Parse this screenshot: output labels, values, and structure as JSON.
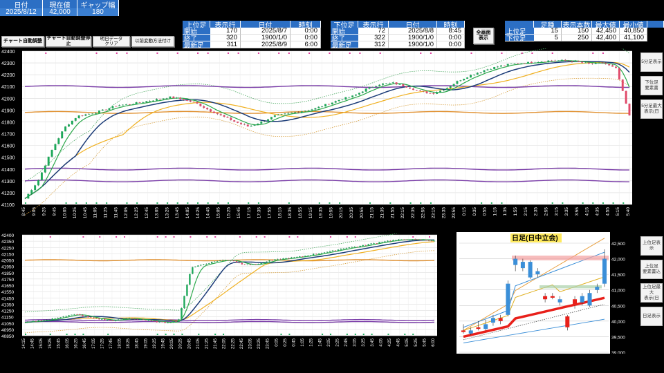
{
  "quote_table": {
    "headers": [
      "日付",
      "現在値",
      "ギャップ幅"
    ],
    "values": [
      "2025/8/12",
      "42,000",
      "180"
    ]
  },
  "buttons": {
    "chart_auto": "チャート自動調整",
    "chart_auto_stop": "チャート自動調整停止",
    "tomorrow_clear": "明日データ\nクリア",
    "before_disp": "以前変動方法付け",
    "full_screen": "全画面\n表示"
  },
  "upper_table": {
    "headers": [
      "上位足",
      "表示行",
      "日付",
      "時刻"
    ],
    "rows": [
      {
        "label": "開始",
        "row": "170",
        "date": "2025/8/7",
        "time": "0:00"
      },
      {
        "label": "終了",
        "row": "320",
        "date": "1900/1/0",
        "time": "0:00"
      },
      {
        "label": "最新足",
        "row": "311",
        "date": "2025/8/9",
        "time": "6:00"
      }
    ]
  },
  "lower_table": {
    "headers": [
      "下位足",
      "表示行",
      "日付",
      "時刻"
    ],
    "rows": [
      {
        "label": "開始",
        "row": "72",
        "date": "2025/8/8",
        "time": "8:45"
      },
      {
        "label": "終了",
        "row": "322",
        "date": "1900/1/0",
        "time": "0:00"
      },
      {
        "label": "最新足",
        "row": "312",
        "date": "1900/1/0",
        "time": "0:00"
      }
    ]
  },
  "ashi_table": {
    "headers": [
      "",
      "足種",
      "表示本数",
      "最大値",
      "最小値"
    ],
    "rows": [
      {
        "label": "上位足",
        "kind": "15",
        "count": "150",
        "max": "42,450",
        "min": "40,850"
      },
      {
        "label": "下位足",
        "kind": "5",
        "count": "250",
        "max": "42,400",
        "min": "41,100"
      }
    ]
  },
  "side_buttons": {
    "upper": [
      "5分足表示",
      "下位足\n要素書",
      "5分足最大\n表示(日"
    ],
    "lower": [
      "上位足表示",
      "上位足\n要素書込",
      "上位足最大\n表示(日",
      "日足表示"
    ]
  },
  "colors": {
    "header_blue": "#2c6fc4",
    "bull": "#1ea85a",
    "bear": "#e04a6a",
    "ma_fast": "#2aa84a",
    "ma_mid": "#1c3c78",
    "ma_slow": "#f0b020",
    "band": "#7a3da8",
    "day_up": "#3b8fd8",
    "day_down": "#e8201a"
  },
  "chart_data": [
    {
      "type": "candlestick",
      "title": "",
      "ylim": [
        41100,
        42400
      ],
      "y_ticks": [
        "42400",
        "42300",
        "42200",
        "42100",
        "42000",
        "41900",
        "41800",
        "41700",
        "41600",
        "41500",
        "41400",
        "41300",
        "41200",
        "41100"
      ],
      "x_ticks": [
        "8:45",
        "9:05",
        "9:25",
        "9:45",
        "10:05",
        "10:25",
        "10:45",
        "11:05",
        "11:25",
        "11:45",
        "12:05",
        "12:25",
        "12:45",
        "13:05",
        "13:25",
        "13:45",
        "14:05",
        "14:25",
        "14:45",
        "15:05",
        "15:25",
        "15:45",
        "17:15",
        "17:35",
        "17:55",
        "18:15",
        "18:35",
        "18:55",
        "19:15",
        "19:35",
        "19:55",
        "20:15",
        "20:35",
        "20:55",
        "21:15",
        "21:35",
        "21:55",
        "22:15",
        "22:35",
        "22:55",
        "23:15",
        "23:35",
        "23:55",
        "0:15",
        "0:35",
        "0:55",
        "1:15",
        "1:35",
        "1:55",
        "2:15",
        "2:35",
        "2:55",
        "3:15",
        "3:35",
        "3:55",
        "4:15",
        "4:35",
        "4:55",
        "5:15",
        "5:40"
      ],
      "close_path": [
        41150,
        41300,
        41550,
        41750,
        41850,
        41870,
        41900,
        41940,
        41950,
        41970,
        41990,
        42010,
        41990,
        41960,
        41900,
        41850,
        41800,
        41760,
        41800,
        41850,
        41870,
        41890,
        41910,
        41950,
        41990,
        42020,
        42080,
        42120,
        42130,
        42100,
        42060,
        42040,
        42080,
        42150,
        42200,
        42240,
        42270,
        42290,
        42300,
        42310,
        42320,
        42320,
        42310,
        42290,
        42300,
        42250,
        41850
      ],
      "bands": [
        41200,
        41900,
        42100,
        41300
      ]
    },
    {
      "type": "candlestick",
      "title": "",
      "ylim": [
        40850,
        42400
      ],
      "y_ticks": [
        "42400",
        "42350",
        "42250",
        "42150",
        "42050",
        "41950",
        "41850",
        "41750",
        "41650",
        "41550",
        "41450",
        "41350",
        "41250",
        "41150",
        "41050",
        "40950",
        "40850"
      ],
      "x_ticks": [
        "14:15",
        "14:45",
        "15:05",
        "15:25",
        "15:45",
        "16:05",
        "16:25",
        "16:45",
        "17:05",
        "17:25",
        "17:45",
        "18:05",
        "18:25",
        "18:45",
        "19:05",
        "19:25",
        "19:45",
        "20:05",
        "20:25",
        "20:45",
        "21:05",
        "21:25",
        "21:45",
        "22:05",
        "22:25",
        "22:45",
        "23:05",
        "23:25",
        "23:45",
        "0:05",
        "0:25",
        "0:45",
        "1:05",
        "1:25",
        "1:45",
        "2:05",
        "2:25",
        "2:45",
        "3:05",
        "3:25",
        "3:45",
        "4:05",
        "4:25",
        "4:45",
        "5:05",
        "5:25",
        "5:45",
        "6:00"
      ],
      "close_path": [
        41050,
        41080,
        41100,
        41150,
        41180,
        41130,
        41100,
        41080,
        41120,
        41100,
        41070,
        41050,
        41080,
        41900,
        41950,
        42000,
        42020,
        41950,
        41940,
        42000,
        42030,
        42050,
        42080,
        42120,
        42150,
        42200,
        42220,
        42260,
        42300,
        42320,
        42330,
        42320,
        42310
      ]
    },
    {
      "type": "candlestick",
      "title": "日足(日中立会)",
      "ylim": [
        39000,
        42500
      ],
      "y_ticks": [
        "42,500",
        "42,000",
        "41,500",
        "41,000",
        "40,500",
        "40,000",
        "39,500",
        "39,000"
      ],
      "candles": [
        {
          "o": 39700,
          "c": 39650,
          "h": 39900,
          "l": 39600
        },
        {
          "o": 39600,
          "c": 39700,
          "h": 39800,
          "l": 39550
        },
        {
          "o": 39800,
          "c": 39750,
          "h": 40000,
          "l": 39700
        },
        {
          "o": 39750,
          "c": 39900,
          "h": 40050,
          "l": 39700
        },
        {
          "o": 39950,
          "c": 40100,
          "h": 40200,
          "l": 39850
        },
        {
          "o": 40100,
          "c": 40000,
          "h": 40200,
          "l": 39900
        },
        {
          "o": 40200,
          "c": 41200,
          "h": 41300,
          "l": 40150
        },
        {
          "o": 41800,
          "c": 42000,
          "h": 42100,
          "l": 41600
        },
        {
          "o": 41700,
          "c": 41900,
          "h": 42000,
          "l": 41600
        },
        {
          "o": 41400,
          "c": 41900,
          "h": 41950,
          "l": 41350
        },
        {
          "o": 41500,
          "c": 41600,
          "h": 41700,
          "l": 41400
        },
        {
          "o": 40800,
          "c": 40700,
          "h": 40900,
          "l": 40600
        },
        {
          "o": 40800,
          "c": 40750,
          "h": 40900,
          "l": 40700
        },
        {
          "o": 40600,
          "c": 40700,
          "h": 40800,
          "l": 40500
        },
        {
          "o": 40150,
          "c": 39800,
          "h": 40200,
          "l": 39700
        },
        {
          "o": 40700,
          "c": 40500,
          "h": 40800,
          "l": 40400
        },
        {
          "o": 40600,
          "c": 40800,
          "h": 40900,
          "l": 40500
        },
        {
          "o": 40500,
          "c": 40900,
          "h": 41000,
          "l": 40450
        },
        {
          "o": 41000,
          "c": 41100,
          "h": 41200,
          "l": 40900
        },
        {
          "o": 41200,
          "c": 42000,
          "h": 42300,
          "l": 41100
        }
      ]
    }
  ]
}
